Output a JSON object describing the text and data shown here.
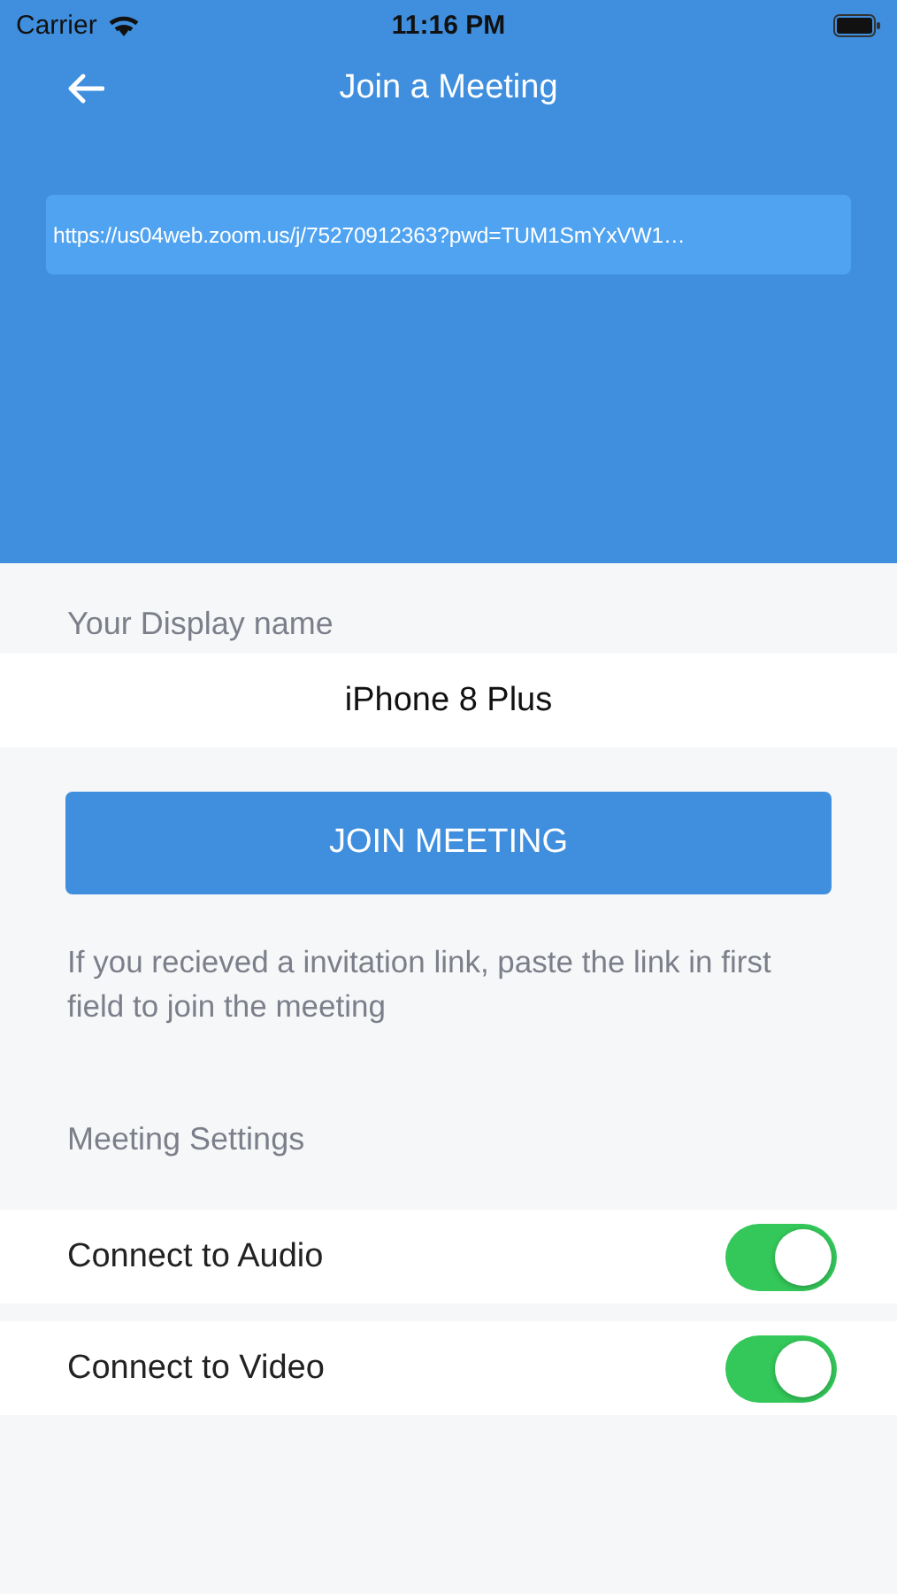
{
  "status_bar": {
    "carrier": "Carrier",
    "time": "11:16 PM"
  },
  "nav_bar": {
    "title": "Join a Meeting"
  },
  "meeting_link_field": {
    "value": "https://us04web.zoom.us/j/75270912363?pwd=TUM1SmYxVW1…"
  },
  "display_name": {
    "label": "Your Display name",
    "value": "iPhone 8 Plus"
  },
  "join_button": "JOIN MEETING",
  "hint": "If you recieved a invitation link, paste the link in first field to join the meeting",
  "settings": {
    "title": "Meeting Settings",
    "items": [
      {
        "label": "Connect to Audio",
        "on": true
      },
      {
        "label": "Connect to Video",
        "on": true
      }
    ]
  }
}
